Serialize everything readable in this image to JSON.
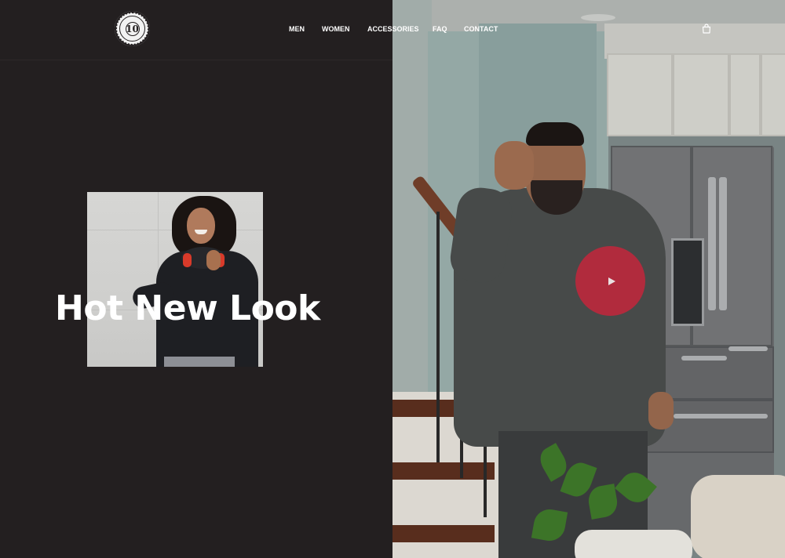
{
  "brand": {
    "logo_number": "10",
    "logo_text": "TOES DOWN"
  },
  "nav": {
    "items": [
      {
        "label": "MEN"
      },
      {
        "label": "WOMEN"
      },
      {
        "label": "ACCESSORIES"
      },
      {
        "label": "FAQ"
      },
      {
        "label": "CONTACT"
      }
    ],
    "cart_icon": "shopping-bag-icon"
  },
  "hero": {
    "title": "Hot New Look",
    "image_icon": "model-photo"
  },
  "video": {
    "play_icon": "play-icon",
    "play_color": "#c8243a"
  },
  "colors": {
    "background": "#231f20",
    "text": "#ffffff"
  }
}
